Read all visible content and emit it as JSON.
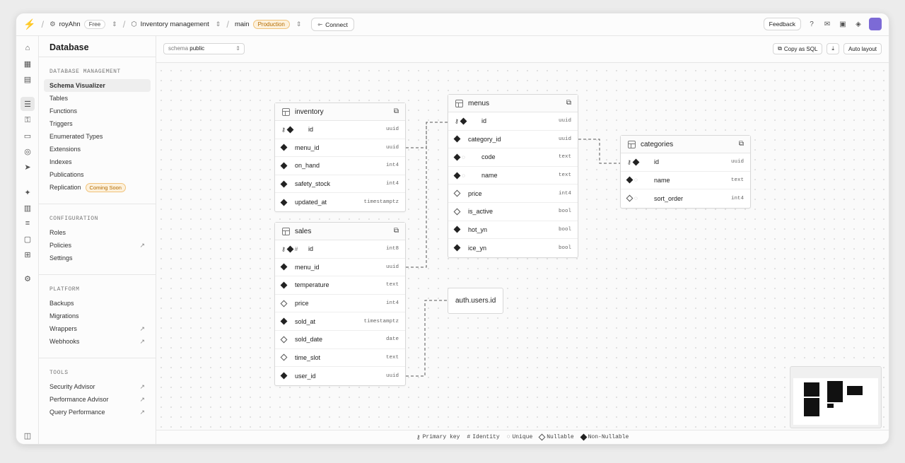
{
  "topbar": {
    "org": "royAhn",
    "plan": "Free",
    "project": "Inventory management",
    "branch": "main",
    "env": "Production",
    "connect": "Connect",
    "feedback": "Feedback"
  },
  "sidebar": {
    "title": "Database",
    "sections": [
      {
        "title": "DATABASE MANAGEMENT",
        "items": [
          {
            "label": "Schema Visualizer",
            "active": true
          },
          {
            "label": "Tables"
          },
          {
            "label": "Functions"
          },
          {
            "label": "Triggers"
          },
          {
            "label": "Enumerated Types"
          },
          {
            "label": "Extensions"
          },
          {
            "label": "Indexes"
          },
          {
            "label": "Publications"
          },
          {
            "label": "Replication",
            "badge": "Coming Soon"
          }
        ]
      },
      {
        "title": "CONFIGURATION",
        "items": [
          {
            "label": "Roles"
          },
          {
            "label": "Policies",
            "external": true
          },
          {
            "label": "Settings"
          }
        ]
      },
      {
        "title": "PLATFORM",
        "items": [
          {
            "label": "Backups"
          },
          {
            "label": "Migrations"
          },
          {
            "label": "Wrappers",
            "external": true
          },
          {
            "label": "Webhooks",
            "external": true
          }
        ]
      },
      {
        "title": "TOOLS",
        "items": [
          {
            "label": "Security Advisor",
            "external": true
          },
          {
            "label": "Performance Advisor",
            "external": true
          },
          {
            "label": "Query Performance",
            "external": true
          }
        ]
      }
    ]
  },
  "toolbar": {
    "schema_label": "schema",
    "schema_value": "public",
    "copy_sql": "Copy as SQL",
    "auto_layout": "Auto layout"
  },
  "tables": {
    "inventory": {
      "name": "inventory",
      "columns": [
        {
          "name": "id",
          "type": "uuid",
          "pk": true
        },
        {
          "name": "menu_id",
          "type": "uuid"
        },
        {
          "name": "on_hand",
          "type": "int4"
        },
        {
          "name": "safety_stock",
          "type": "int4"
        },
        {
          "name": "updated_at",
          "type": "timestamptz"
        }
      ]
    },
    "menus": {
      "name": "menus",
      "columns": [
        {
          "name": "id",
          "type": "uuid",
          "pk": true
        },
        {
          "name": "category_id",
          "type": "uuid"
        },
        {
          "name": "code",
          "type": "text",
          "unique": true
        },
        {
          "name": "name",
          "type": "text",
          "unique": true
        },
        {
          "name": "price",
          "type": "int4",
          "nullable": true
        },
        {
          "name": "is_active",
          "type": "bool",
          "nullable": true
        },
        {
          "name": "hot_yn",
          "type": "bool"
        },
        {
          "name": "ice_yn",
          "type": "bool"
        }
      ]
    },
    "categories": {
      "name": "categories",
      "columns": [
        {
          "name": "id",
          "type": "uuid",
          "pk": true
        },
        {
          "name": "name",
          "type": "text",
          "unique": true
        },
        {
          "name": "sort_order",
          "type": "int4",
          "nullable": true,
          "unique": true
        }
      ]
    },
    "sales": {
      "name": "sales",
      "columns": [
        {
          "name": "id",
          "type": "int8",
          "pk": true,
          "identity": true
        },
        {
          "name": "menu_id",
          "type": "uuid"
        },
        {
          "name": "temperature",
          "type": "text"
        },
        {
          "name": "price",
          "type": "int4",
          "nullable": true
        },
        {
          "name": "sold_at",
          "type": "timestamptz"
        },
        {
          "name": "sold_date",
          "type": "date",
          "nullable": true
        },
        {
          "name": "time_slot",
          "type": "text",
          "nullable": true
        },
        {
          "name": "user_id",
          "type": "uuid"
        }
      ]
    }
  },
  "ref": {
    "label": "auth.users.id"
  },
  "legend": {
    "primary": "Primary key",
    "identity": "Identity",
    "unique": "Unique",
    "nullable": "Nullable",
    "nonnull": "Non-Nullable"
  }
}
